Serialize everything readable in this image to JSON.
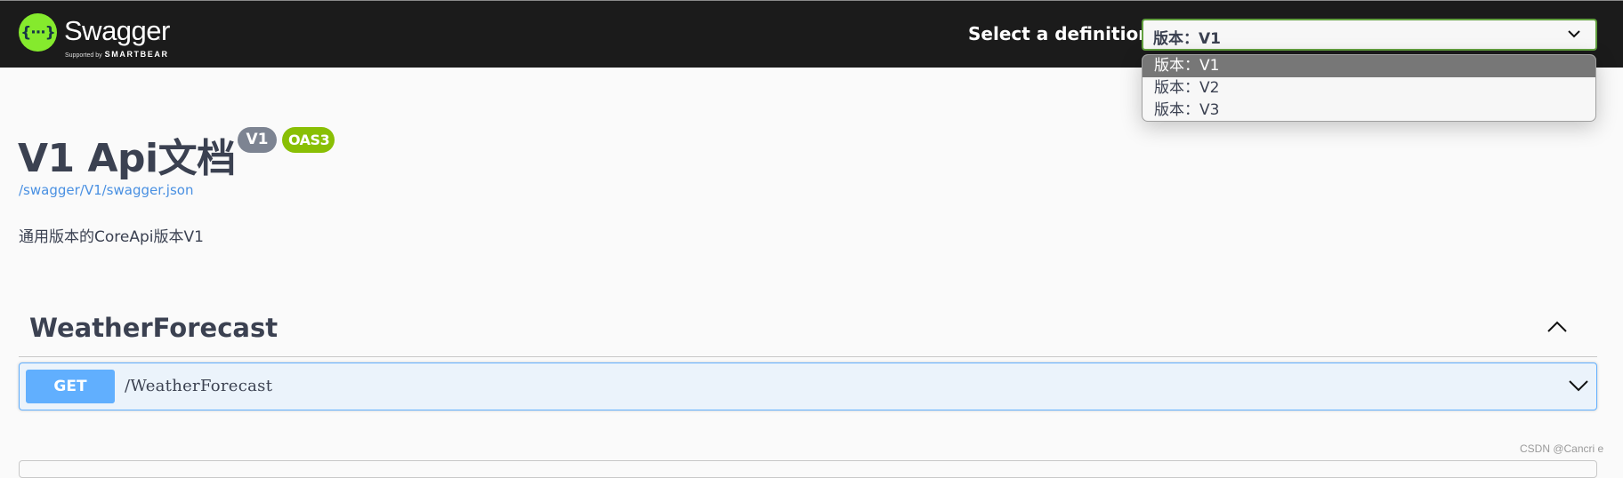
{
  "topbar": {
    "logo_glyph": "{···}",
    "brand": "Swagger",
    "trademark": "™",
    "supported_by": "Supported by",
    "company": "SMARTBEAR",
    "select_label": "Select a definition",
    "selected_definition": "版本：V1",
    "definitions": [
      {
        "label": "版本：V1",
        "selected": true
      },
      {
        "label": "版本：V2",
        "selected": false
      },
      {
        "label": "版本：V3",
        "selected": false
      }
    ]
  },
  "info": {
    "title": "V1 Api文档",
    "version_badge": "V1",
    "oas_badge": "OAS3",
    "spec_link": "/swagger/V1/swagger.json",
    "description": "通用版本的CoreApi版本V1"
  },
  "tags": [
    {
      "name": "WeatherForecast",
      "expanded": true,
      "toggle_icon": "chevron-up-icon",
      "operations": [
        {
          "method": "GET",
          "path": "/WeatherForecast",
          "toggle_icon": "chevron-down-icon"
        }
      ]
    }
  ],
  "watermark": "CSDN @Cancri e",
  "colors": {
    "topbar_bg": "#1b1b1b",
    "logo_green": "#85ea2d",
    "select_border": "#62a03f",
    "link": "#4990e2",
    "version_badge": "#7d8492",
    "oas_badge": "#89bf04",
    "get_method": "#61affe",
    "get_block_bg": "#ebf3fb",
    "text": "#3b4151"
  }
}
